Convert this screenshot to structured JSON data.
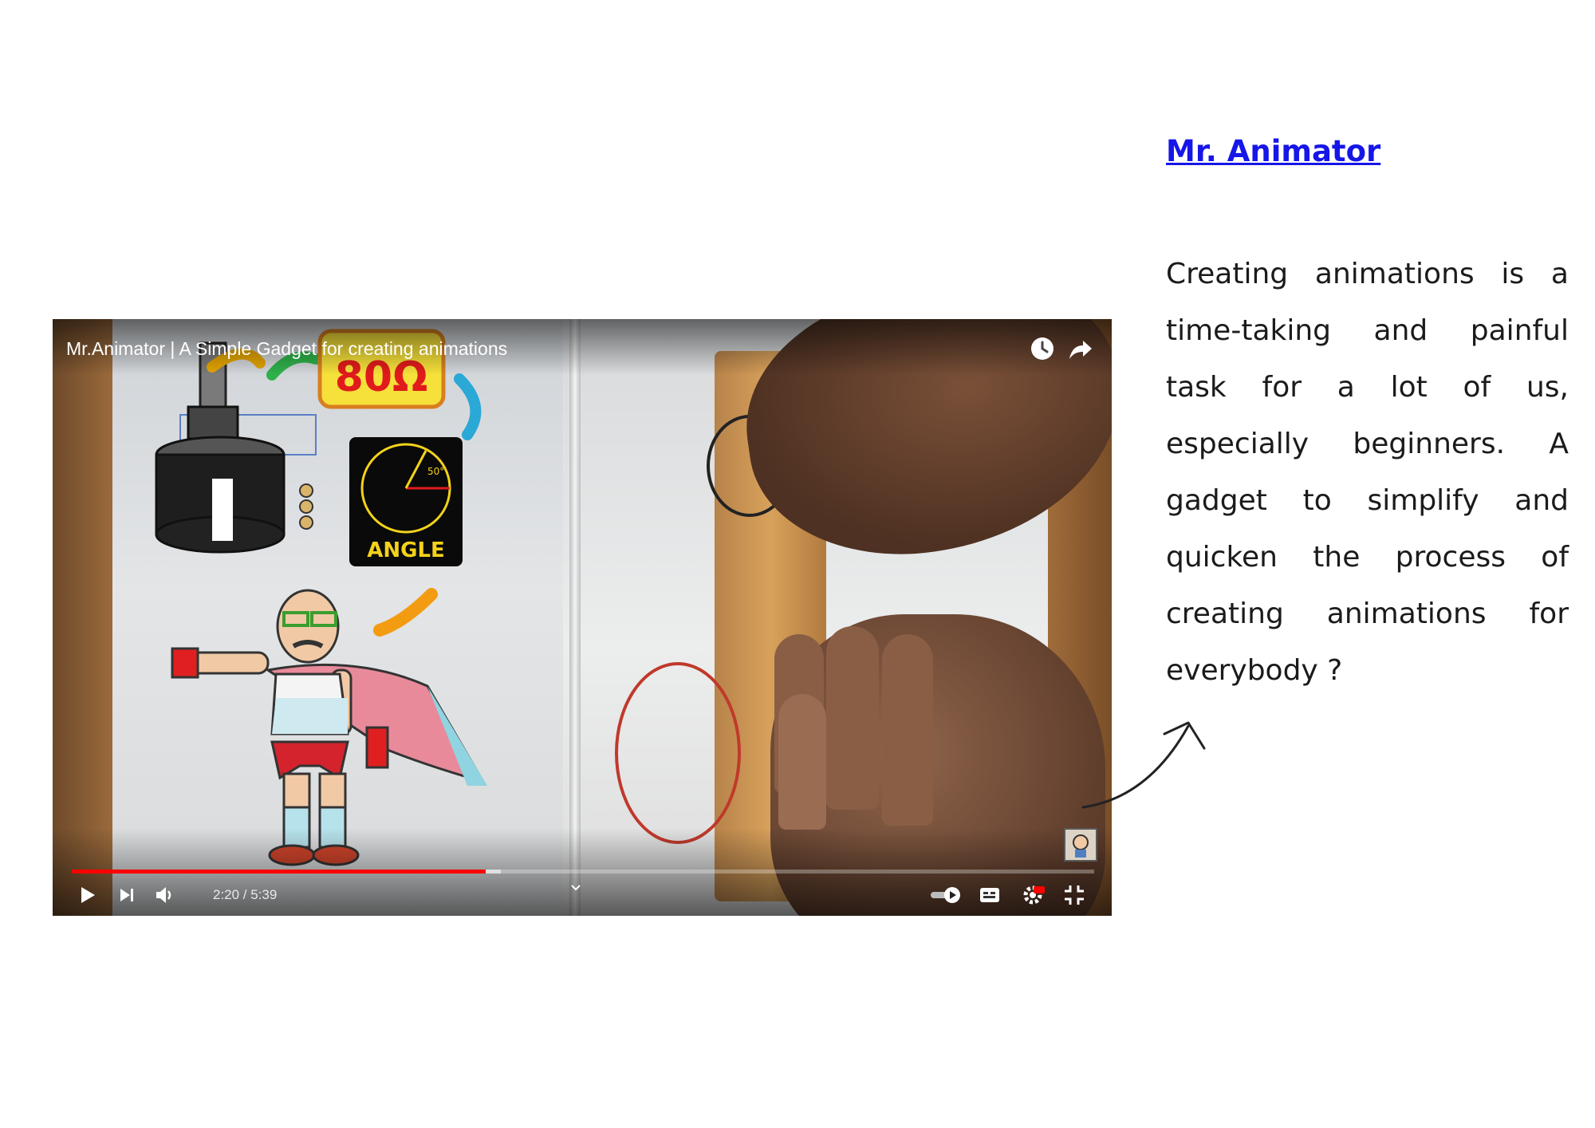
{
  "video_player": {
    "title": "Mr.Animator | A Simple Gadget for creating animations",
    "time_display": "2:20 / 5:39",
    "progress_played_fraction": 0.405,
    "progress_buffered_fraction": 0.42,
    "overlay_labels": {
      "resistance_value": "80Ω",
      "angle_label": "ANGLE",
      "angle_value": "50°"
    },
    "icons": {
      "watch_later": "clock-icon",
      "share": "share-arrow-icon",
      "play": "play-icon",
      "next": "skip-next-icon",
      "volume": "volume-icon",
      "autoplay": "autoplay-toggle-icon",
      "captions": "captions-icon",
      "settings": "settings-gear-icon",
      "exit_fullscreen": "exit-fullscreen-icon"
    },
    "accent_color": "#ff0000"
  },
  "sidebar": {
    "channel_link": "Mr. Animator",
    "link_color": "#1616e8",
    "description": "Creating animations is a time-taking and painful task for a lot of us, especially beginners. A gadget to simplify and quicken the process of creating animations for everybody ?"
  }
}
